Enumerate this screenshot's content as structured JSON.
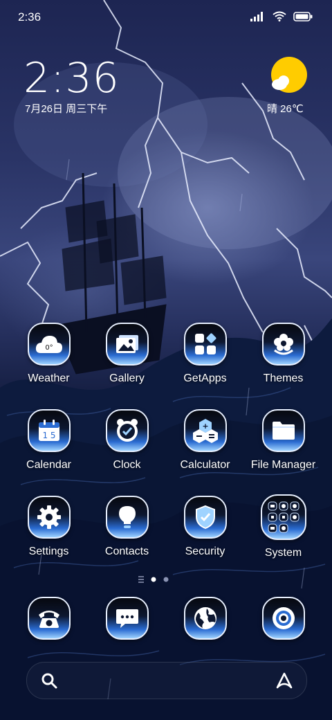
{
  "status_bar": {
    "time": "2:36",
    "icons": [
      "signal-icon",
      "wifi-icon",
      "battery-icon"
    ]
  },
  "clock_widget": {
    "time": "2:36",
    "date": "7月26日 周三下午"
  },
  "weather_widget": {
    "icon": "sunny-cloud-icon",
    "text": "晴 26℃"
  },
  "apps": [
    {
      "label": "Weather",
      "icon": "weather-icon",
      "badge": "0°"
    },
    {
      "label": "Gallery",
      "icon": "gallery-icon"
    },
    {
      "label": "GetApps",
      "icon": "getapps-icon"
    },
    {
      "label": "Themes",
      "icon": "themes-icon"
    },
    {
      "label": "Calendar",
      "icon": "calendar-icon",
      "badge": "1 5"
    },
    {
      "label": "Clock",
      "icon": "clock-icon"
    },
    {
      "label": "Calculator",
      "icon": "calculator-icon"
    },
    {
      "label": "File Manager",
      "icon": "file-manager-icon"
    },
    {
      "label": "Settings",
      "icon": "settings-icon"
    },
    {
      "label": "Contacts",
      "icon": "contacts-icon"
    },
    {
      "label": "Security",
      "icon": "security-icon"
    },
    {
      "label": "System",
      "icon": "system-folder-icon"
    }
  ],
  "pager": {
    "pages": 2,
    "current": 1
  },
  "dock": [
    {
      "icon": "phone-icon"
    },
    {
      "icon": "messages-icon"
    },
    {
      "icon": "browser-icon"
    },
    {
      "icon": "camera-icon"
    }
  ],
  "search_bar": {
    "left_icon": "search-icon",
    "right_icon": "assistant-icon"
  },
  "colors": {
    "accent": "#2a6bd1",
    "accent_light": "#9fd3ff",
    "sun": "#ffcc00"
  }
}
